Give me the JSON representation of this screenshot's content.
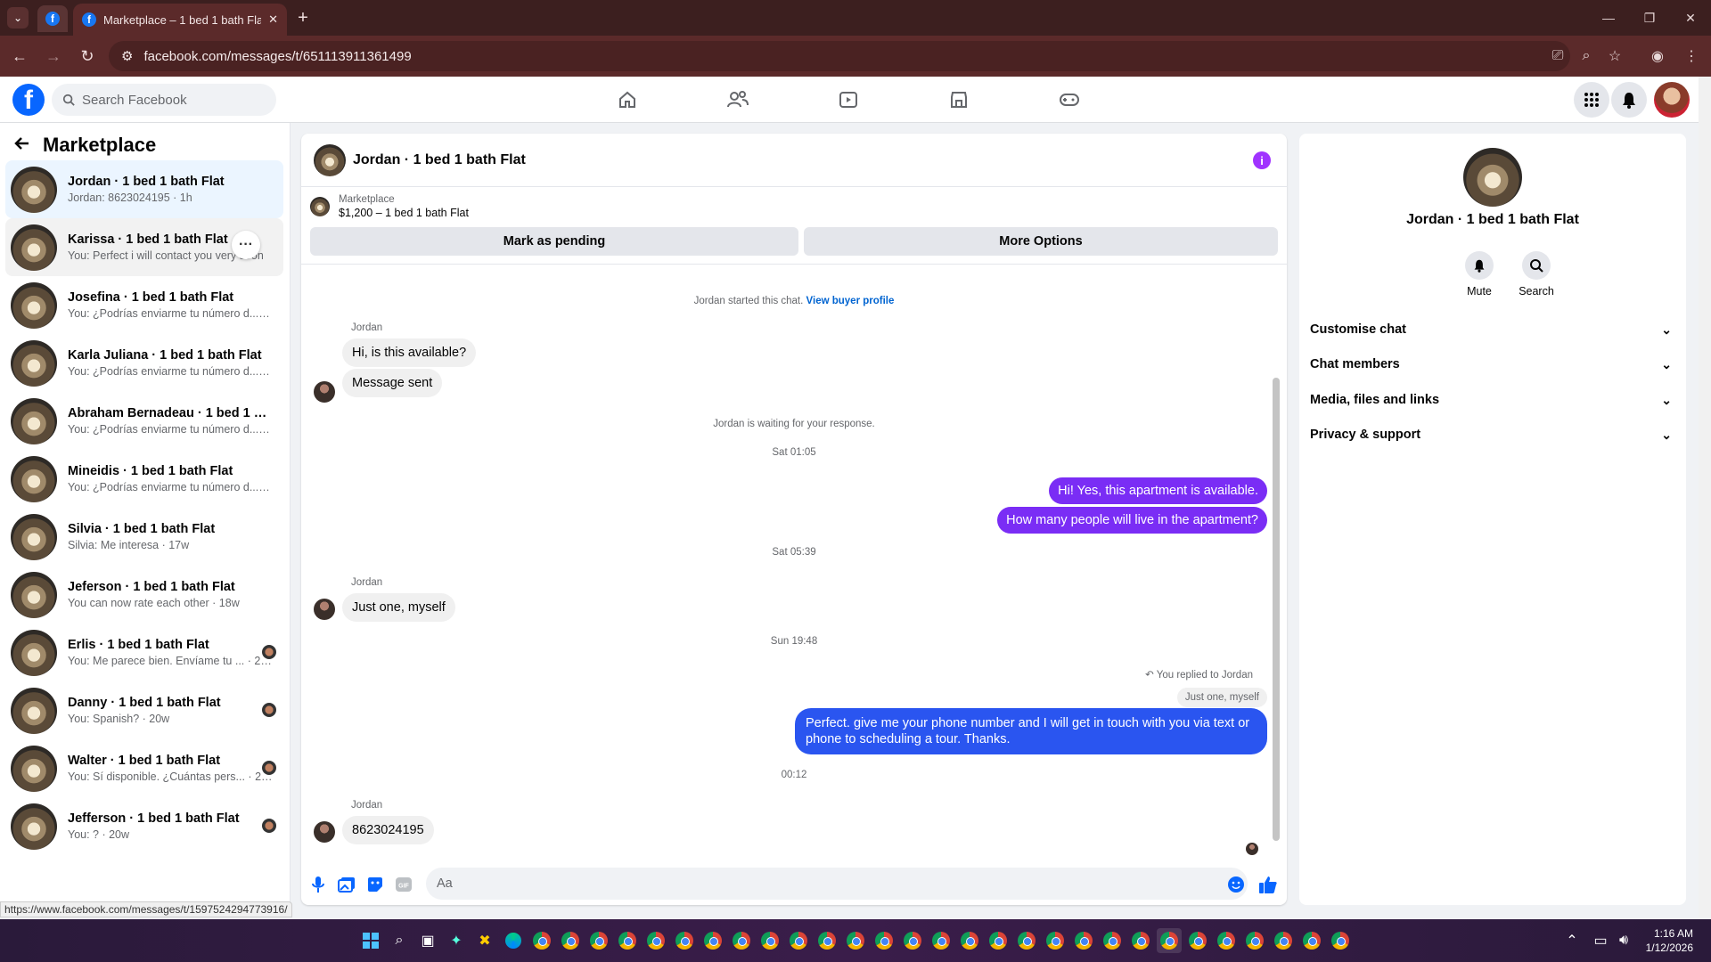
{
  "browser": {
    "tab_title": "Marketplace – 1 bed 1 bath Flat",
    "url": "facebook.com/messages/t/651113911361499",
    "status_url": "https://www.facebook.com/messages/t/1597524294773916/"
  },
  "fb": {
    "search_placeholder": "Search Facebook"
  },
  "left": {
    "title": "Marketplace",
    "conversations": [
      {
        "name": "Jordan · 1 bed 1 bath Flat",
        "preview": "Jordan: 8623024195 · 1h"
      },
      {
        "name": "Karissa · 1 bed 1 bath Flat",
        "preview": "You: Perfect i will contact you very soon"
      },
      {
        "name": "Josefina · 1 bed 1 bath Flat",
        "preview": "You: ¿Podrías enviarme tu número d... · 17w"
      },
      {
        "name": "Karla Juliana · 1 bed 1 bath Flat",
        "preview": "You: ¿Podrías enviarme tu número d... · 17w"
      },
      {
        "name": "Abraham Bernadeau · 1 bed 1 bath...",
        "preview": "You: ¿Podrías enviarme tu número d... · 17w"
      },
      {
        "name": "Mineidis · 1 bed 1 bath Flat",
        "preview": "You: ¿Podrías enviarme tu número d... · 17w"
      },
      {
        "name": "Silvia · 1 bed 1 bath Flat",
        "preview": "Silvia: Me interesa · 17w"
      },
      {
        "name": "Jeferson · 1 bed 1 bath Flat",
        "preview": "You can now rate each other · 18w"
      },
      {
        "name": "Erlis · 1 bed 1 bath Flat",
        "preview": "You: Me parece bien. Envíame tu ... · 20w"
      },
      {
        "name": "Danny · 1 bed 1 bath Flat",
        "preview": "You: Spanish? · 20w"
      },
      {
        "name": "Walter · 1 bed 1 bath Flat",
        "preview": "You: Sí disponible. ¿Cuántas pers... · 20w"
      },
      {
        "name": "Jefferson · 1 bed 1 bath Flat",
        "preview": "You: ? · 20w"
      }
    ]
  },
  "chat": {
    "title": "Jordan · 1 bed 1 bath Flat",
    "listing_source": "Marketplace",
    "listing_price": "$1,200 – 1 bed 1 bath Flat",
    "mark_pending": "Mark as pending",
    "more_options": "More Options",
    "started_text": "Jordan started this chat.",
    "buyer_profile": "View buyer profile",
    "sender": "Jordan",
    "msg1": "Hi, is this available?",
    "msg2": "Message sent",
    "waiting": "Jordan is waiting for your response.",
    "time1": "Sat 01:05",
    "out1": "Hi! Yes, this apartment is available.",
    "out2": "How many people will live in the apartment?",
    "time2": "Sat 05:39",
    "msg3": "Just one, myself",
    "time3": "Sun 19:48",
    "replied_to": "You replied to Jordan",
    "quote": "Just one, myself",
    "out3_line1": "Perfect. give me your phone number and I will get in touch with you via text or",
    "out3_line2": "phone to scheduling a tour. Thanks.",
    "time4": "00:12",
    "msg4": "8623024195",
    "composer_placeholder": "Aa"
  },
  "right": {
    "name": "Jordan · 1 bed 1 bath Flat",
    "mute": "Mute",
    "search": "Search",
    "sections": [
      "Customise chat",
      "Chat members",
      "Media, files and links",
      "Privacy & support"
    ]
  },
  "taskbar": {
    "time": "1:16 AM",
    "date": "1/12/2026"
  },
  "colors": {
    "accent": "#0866ff",
    "outgoing_purple": "#7a2df5",
    "outgoing_blue": "#2a55f0",
    "browser_frame": "#5b2a2a"
  }
}
